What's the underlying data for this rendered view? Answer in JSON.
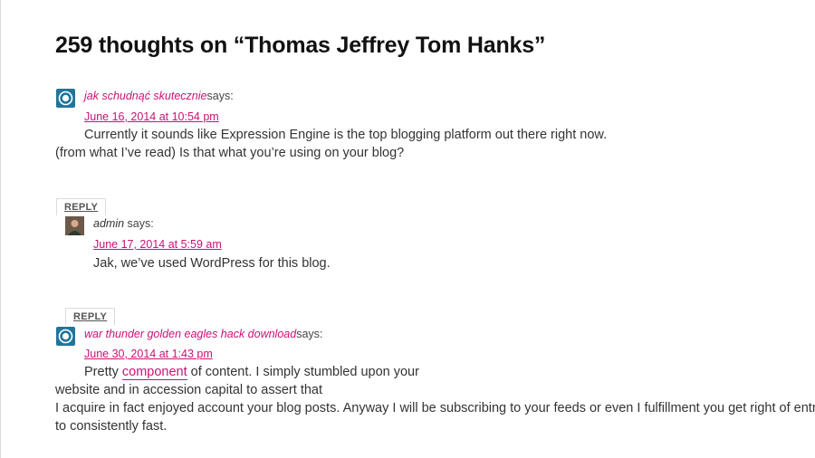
{
  "page": {
    "title": "259 thoughts on “Thomas Jeffrey Tom Hanks”"
  },
  "comments": [
    {
      "author": "jak schudnąć skutecznie",
      "says": "says:",
      "date": "June 16, 2014 at 10:54 pm",
      "lines": [
        "Currently it sounds like Expression Engine is the top blogging platform out there right now.",
        "(from what I’ve read) Is that what you’re using on your blog?"
      ],
      "avatar_icon": "wordpress-icon",
      "reply_label": "REPLY"
    },
    {
      "author": "admin",
      "says": "says:",
      "date": "June 17, 2014 at 5:59 am",
      "lines": [
        "Jak, we’ve used WordPress for this blog."
      ],
      "avatar_icon": "user-photo-icon",
      "reply_label": "REPLY"
    },
    {
      "author": "war thunder golden eagles hack download",
      "says": "says:",
      "date": "June 30, 2014 at 1:43 pm",
      "line1_before": "Pretty ",
      "line1_link": "component",
      "line1_after": " of content. I simply stumbled upon your",
      "lines": [
        "website and in accession capital to assert that",
        "I acquire in fact enjoyed account your blog posts. Anyway I will be subscribing to your feeds or even I fulfillment you get right of entry",
        "to consistently fast."
      ],
      "avatar_icon": "wordpress-icon"
    }
  ],
  "colors": {
    "link": "#cc1177",
    "text": "#333333",
    "avatar_blue": "#21759b"
  }
}
